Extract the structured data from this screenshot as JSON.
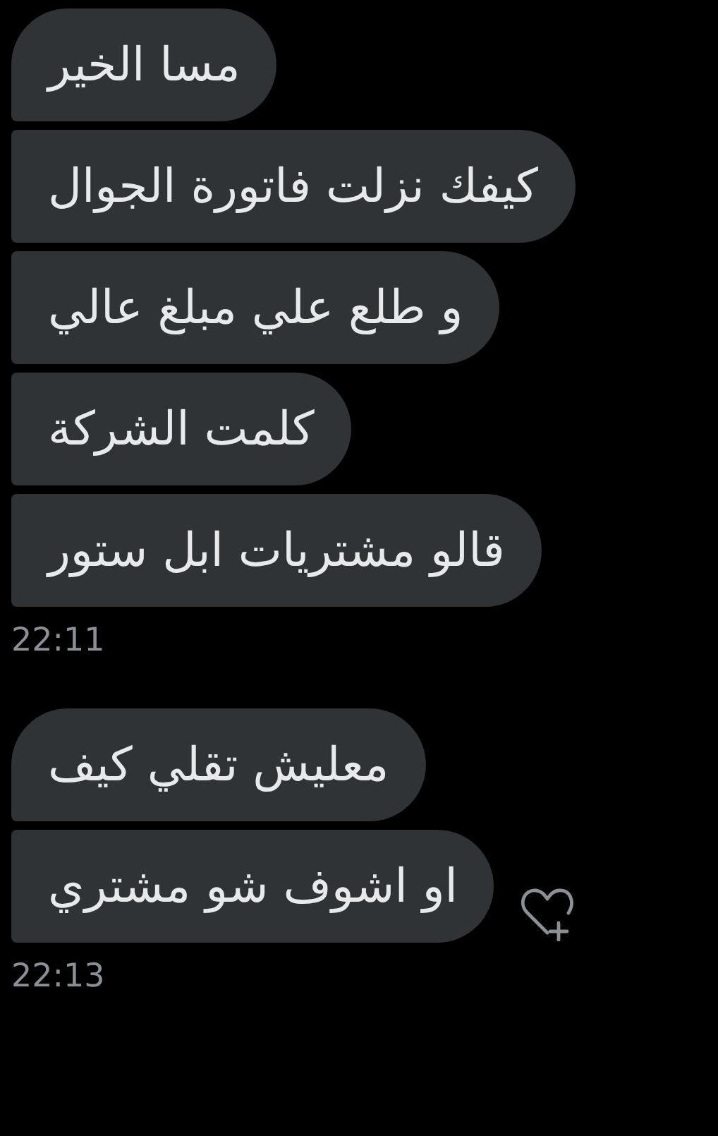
{
  "groups": [
    {
      "messages": [
        {
          "text": "مسا الخير",
          "reaction_button": false
        },
        {
          "text": "كيفك نزلت فاتورة الجوال",
          "reaction_button": false
        },
        {
          "text": "و طلع علي مبلغ عالي",
          "reaction_button": false
        },
        {
          "text": "كلمت الشركة",
          "reaction_button": false
        },
        {
          "text": "قالو مشتريات ابل ستور",
          "reaction_button": false
        }
      ],
      "time": "22:11"
    },
    {
      "messages": [
        {
          "text": "معليش تقلي كيف",
          "reaction_button": false
        },
        {
          "text": "او اشوف شو مشتري",
          "reaction_button": true
        }
      ],
      "time": "22:13"
    }
  ]
}
